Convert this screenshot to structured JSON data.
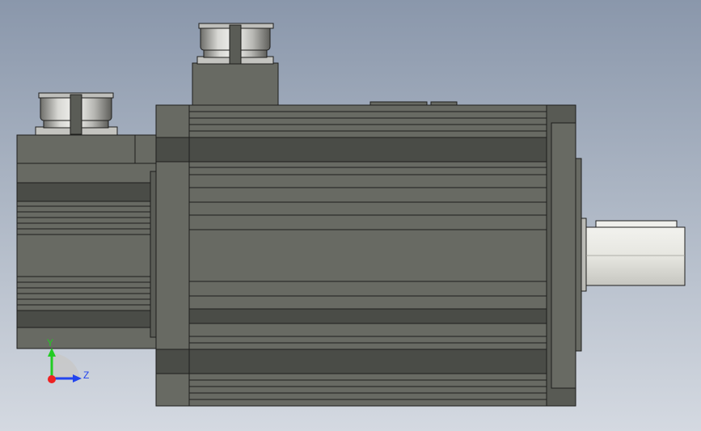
{
  "viewport": {
    "background_top": "#8a97ab",
    "background_bottom": "#d4d9e1"
  },
  "model": {
    "body_color": "#686a63",
    "dark_band_color": "#4a4c47",
    "shaft_color": "#e4e4df",
    "connector_color": "#c4c4c0"
  },
  "triad": {
    "y_label": "Y",
    "z_label": "Z",
    "y_color": "#22cc22",
    "z_color": "#2244ee",
    "origin_color": "#ee2222"
  }
}
